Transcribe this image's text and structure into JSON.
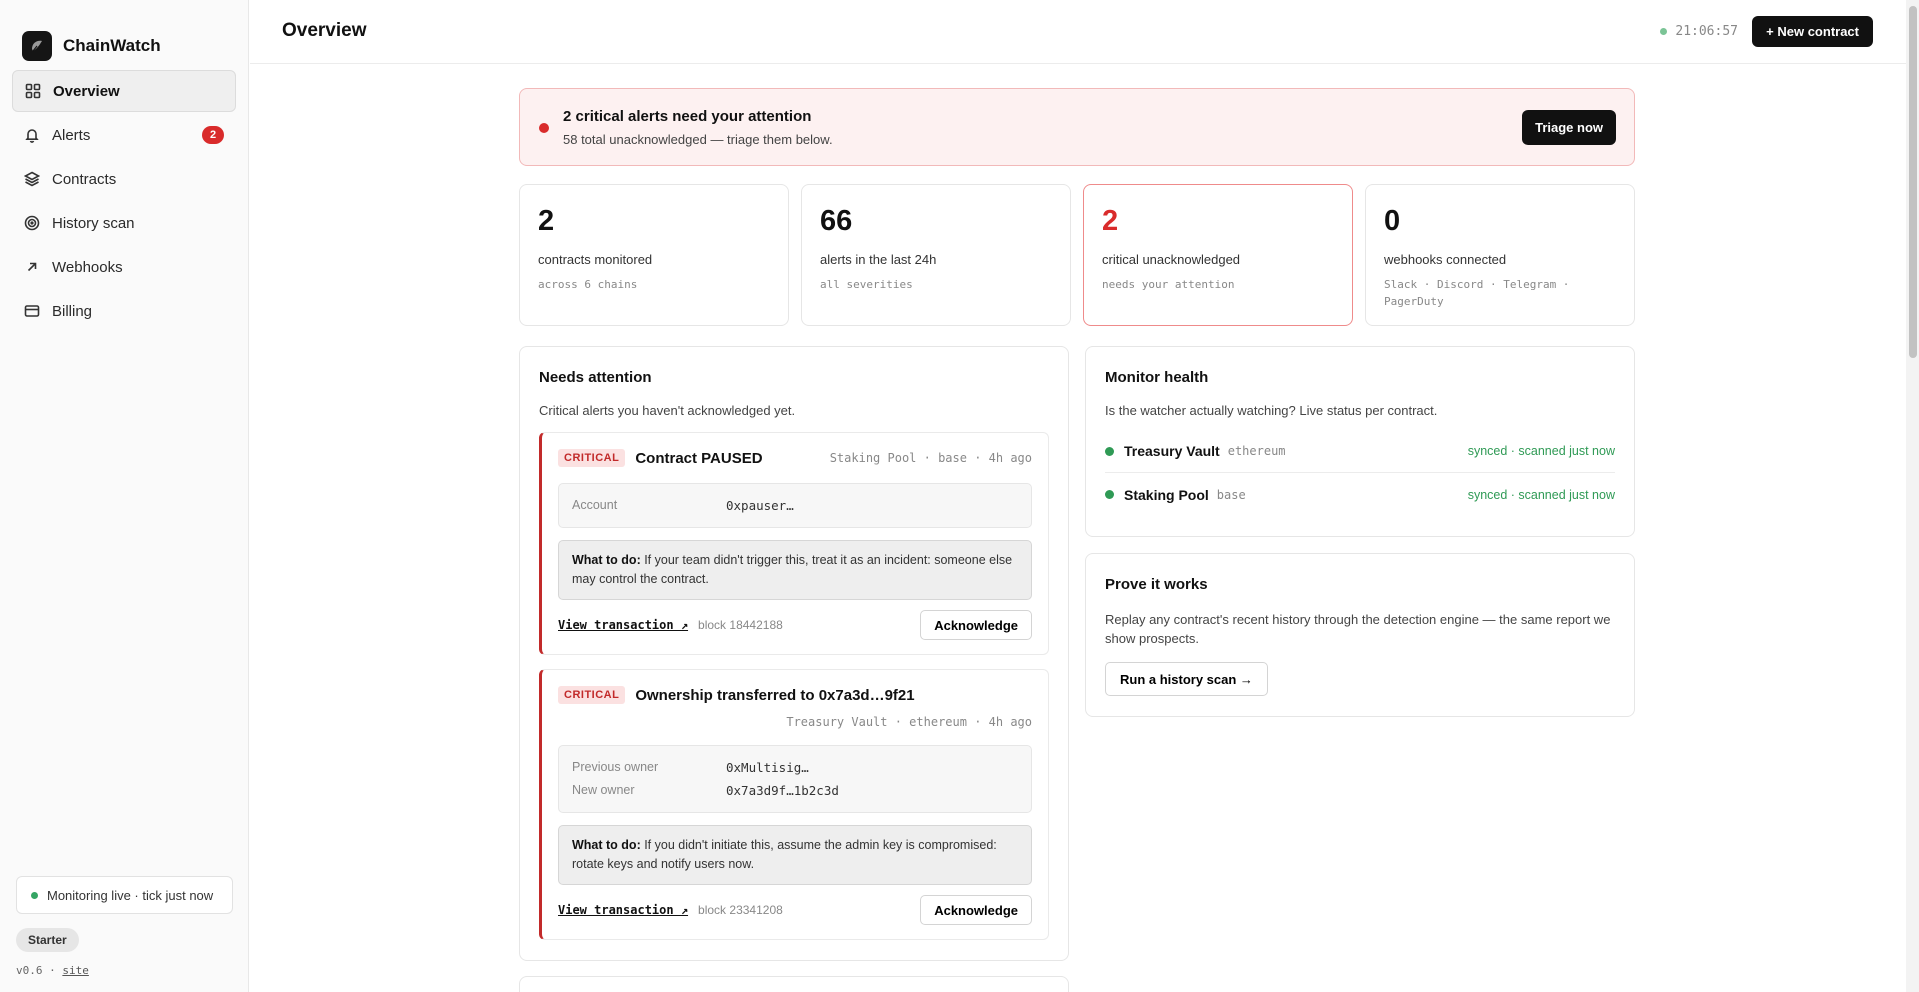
{
  "app": {
    "name": "ChainWatch"
  },
  "sidebar": {
    "items": [
      {
        "label": "Overview",
        "icon": "grid-icon",
        "active": true
      },
      {
        "label": "Alerts",
        "icon": "bell-icon",
        "badge": "2"
      },
      {
        "label": "Contracts",
        "icon": "layers-icon"
      },
      {
        "label": "History scan",
        "icon": "target-icon"
      },
      {
        "label": "Webhooks",
        "icon": "arrow-up-right-icon"
      },
      {
        "label": "Billing",
        "icon": "card-icon"
      }
    ],
    "live_status": "Monitoring live · tick just now",
    "plan": "Starter",
    "version": "v0.6",
    "site_link": "site"
  },
  "header": {
    "title": "Overview",
    "clock": "21:06:57",
    "new_contract": "+ New contract"
  },
  "banner": {
    "title": "2 critical alerts need your attention",
    "subtitle": "58 total unacknowledged — triage them below.",
    "button": "Triage now"
  },
  "stats": [
    {
      "value": "2",
      "label": "contracts monitored",
      "sub": "across 6 chains"
    },
    {
      "value": "66",
      "label": "alerts in the last 24h",
      "sub": "all severities"
    },
    {
      "value": "2",
      "label": "critical unacknowledged",
      "sub": "needs your attention"
    },
    {
      "value": "0",
      "label": "webhooks connected",
      "sub": "Slack · Discord · Telegram · PagerDuty"
    }
  ],
  "needs_attention": {
    "title": "Needs attention",
    "subtitle": "Critical alerts you haven't acknowledged yet.",
    "alerts": [
      {
        "severity": "CRITICAL",
        "title": "Contract PAUSED",
        "meta": "Staking Pool · base · 4h ago",
        "fields": [
          {
            "k": "Account",
            "v": "0xpauser…"
          }
        ],
        "todo_label": "What to do:",
        "todo_text": " If your team didn't trigger this, treat it as an incident: someone else may control the contract.",
        "link": "View transaction ↗",
        "block": "block 18442188",
        "ack": "Acknowledge"
      },
      {
        "severity": "CRITICAL",
        "title": "Ownership transferred to 0x7a3d…9f21",
        "meta": "Treasury Vault · ethereum · 4h ago",
        "fields": [
          {
            "k": "Previous owner",
            "v": "0xMultisig…"
          },
          {
            "k": "New owner",
            "v": "0x7a3d9f…1b2c3d"
          }
        ],
        "todo_label": "What to do:",
        "todo_text": " If you didn't initiate this, assume the admin key is compromised: rotate keys and notify users now.",
        "link": "View transaction ↗",
        "block": "block 23341208",
        "ack": "Acknowledge"
      }
    ]
  },
  "health": {
    "title": "Monitor health",
    "subtitle": "Is the watcher actually watching? Live status per contract.",
    "rows": [
      {
        "name": "Treasury Vault",
        "chain": "ethereum",
        "status": "synced · scanned just now"
      },
      {
        "name": "Staking Pool",
        "chain": "base",
        "status": "synced · scanned just now"
      }
    ]
  },
  "prove": {
    "title": "Prove it works",
    "subtitle": "Replay any contract's recent history through the detection engine — the same report we show prospects.",
    "button": "Run a history scan →"
  }
}
